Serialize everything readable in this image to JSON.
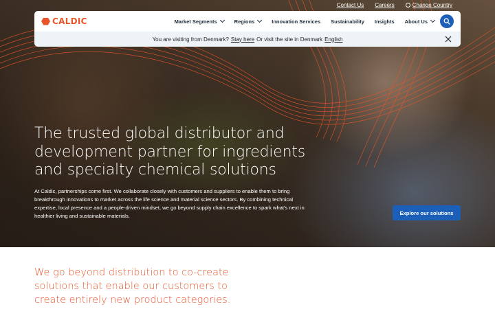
{
  "top_links": {
    "contact": "Contact Us",
    "careers": "Careers",
    "change_country": "Change Country"
  },
  "brand": {
    "name": "CALDIC",
    "accent_color": "#e8552b",
    "primary_button_color": "#1c5fb8"
  },
  "nav": {
    "items": [
      {
        "label": "Market Segments",
        "has_dropdown": true
      },
      {
        "label": "Regions",
        "has_dropdown": true
      },
      {
        "label": "Innovation Services",
        "has_dropdown": false
      },
      {
        "label": "Sustainability",
        "has_dropdown": false
      },
      {
        "label": "Insights",
        "has_dropdown": false
      },
      {
        "label": "About Us",
        "has_dropdown": true
      }
    ],
    "search_icon": "search-icon"
  },
  "notice": {
    "prefix": "You are visiting from Denmark?",
    "stay_link": "Stay here",
    "middle": "Or visit the site in Denmark",
    "language_link": "English",
    "close_icon": "close-icon"
  },
  "hero": {
    "headline": "The trusted global distributor and development partner for ingredients and specialty chemical solutions",
    "body": "At Caldic, partnerships come first. We collaborate closely with customers and suppliers to enable them to bring breakthrough innovations to market across the life science and material science sectors. By combining technical expertise, local presence and a people-driven mindset, we go beyond supply chain excellence to spark what's next in healthier living and sustainable materials.",
    "cta": "Explore our solutions"
  },
  "section": {
    "tagline": "We go beyond distribution to co-create solutions that enable our customers to create entirely new product categories."
  }
}
